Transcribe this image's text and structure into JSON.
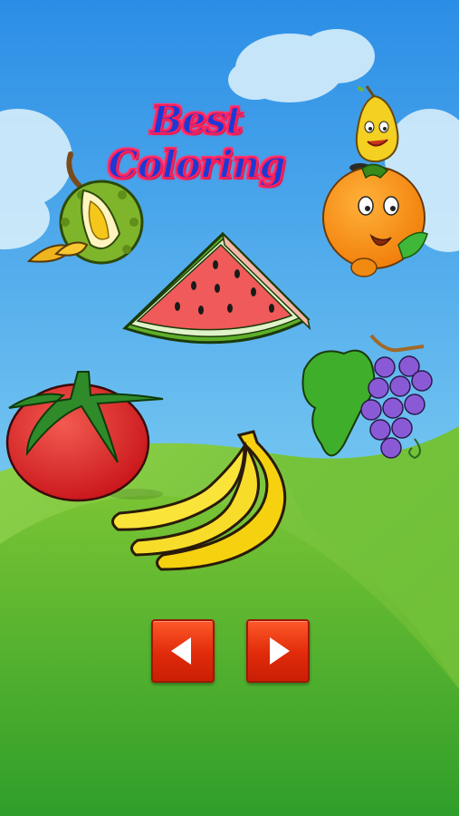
{
  "title": "Best Coloring",
  "fruits": [
    "durian",
    "pear-character",
    "orange-character",
    "watermelon-slice",
    "grapes",
    "tomato",
    "banana"
  ],
  "nav": {
    "prev_icon": "triangle-left-icon",
    "next_icon": "triangle-right-icon"
  },
  "colors": {
    "sky": "#2e9be8",
    "grass": "#5cbf2a",
    "button": "#e02a0a",
    "title_fill": "#1a3ad6",
    "title_outline": "#ff1f5a"
  }
}
